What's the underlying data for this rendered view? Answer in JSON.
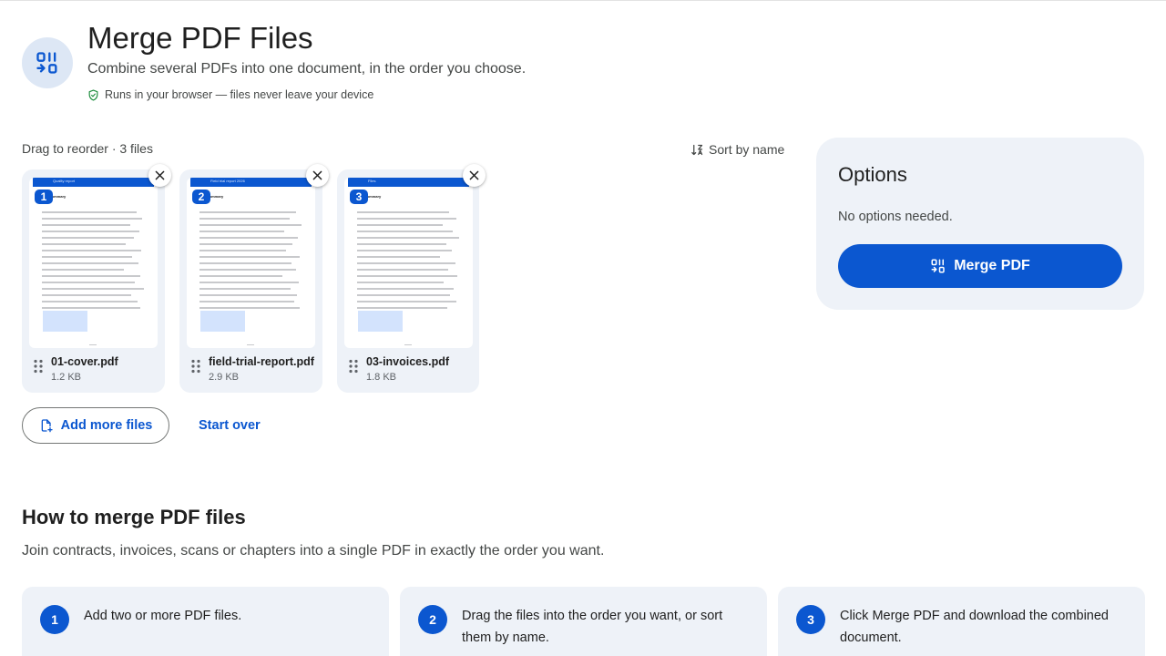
{
  "header": {
    "icon": "merge-icon",
    "title": "Merge PDF Files",
    "subtitle": "Combine several PDFs into one document, in the order you choose.",
    "privacy_icon": "shield-check-icon",
    "privacy_note": "Runs in your browser — files never leave your device"
  },
  "toolbar": {
    "status": "Drag to reorder · 3 files",
    "sort_icon": "sort-icon",
    "sort_label": "Sort by name"
  },
  "files": [
    {
      "order": "1",
      "name": "01-cover.pdf",
      "size": "1.2 KB",
      "thumb_header": "Quality report",
      "thumb_heading": "Summary"
    },
    {
      "order": "2",
      "name": "field-trial-report.pdf",
      "size": "2.9 KB",
      "thumb_header": "Field trial report 2026",
      "thumb_heading": "Summary"
    },
    {
      "order": "3",
      "name": "03-invoices.pdf",
      "size": "1.8 KB",
      "thumb_header": "Files",
      "thumb_heading": "Summary"
    }
  ],
  "actions": {
    "add_more_label": "Add more files",
    "start_over_label": "Start over"
  },
  "options": {
    "title": "Options",
    "note": "No options needed.",
    "merge_label": "Merge PDF"
  },
  "howto": {
    "title": "How to merge PDF files",
    "description": "Join contracts, invoices, scans or chapters into a single PDF in exactly the order you want.",
    "steps": [
      {
        "number": "1",
        "text": "Add two or more PDF files."
      },
      {
        "number": "2",
        "text": "Drag the files into the order you want, or sort them by name."
      },
      {
        "number": "3",
        "text": "Click Merge PDF and download the combined document."
      }
    ]
  },
  "colors": {
    "primary": "#0b57d0",
    "surface": "#eef2f8",
    "text": "#1f1f1f",
    "muted": "#444746"
  }
}
